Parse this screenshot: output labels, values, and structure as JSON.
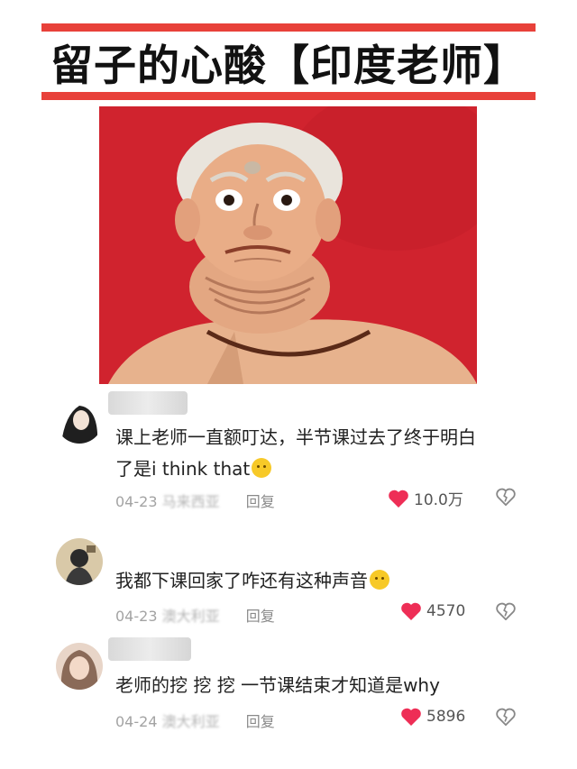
{
  "title": "留子的心酸【印度老师】",
  "colors": {
    "accent": "#e8413a",
    "photo_bg": "#d0232e",
    "heart": "#ee2e56"
  },
  "comments": [
    {
      "text_line1": "课上老师一直额叮达，半节课过去了终于明白",
      "text_line2": "了是i think that",
      "emoji": "smiling-face-with-sweat",
      "date": "04-23",
      "location": "马来西亚",
      "reply": "回复",
      "likes": "10.0万"
    },
    {
      "text_line1": "我都下课回家了咋还有这种声音",
      "emoji": "loudly-crying-face",
      "date": "04-23",
      "location": "澳大利亚",
      "reply": "回复",
      "likes": "4570"
    },
    {
      "text_line1": "老师的挖 挖 挖 一节课结束才知道是why",
      "date": "04-24",
      "location": "澳大利亚",
      "reply": "回复",
      "likes": "5896"
    }
  ]
}
